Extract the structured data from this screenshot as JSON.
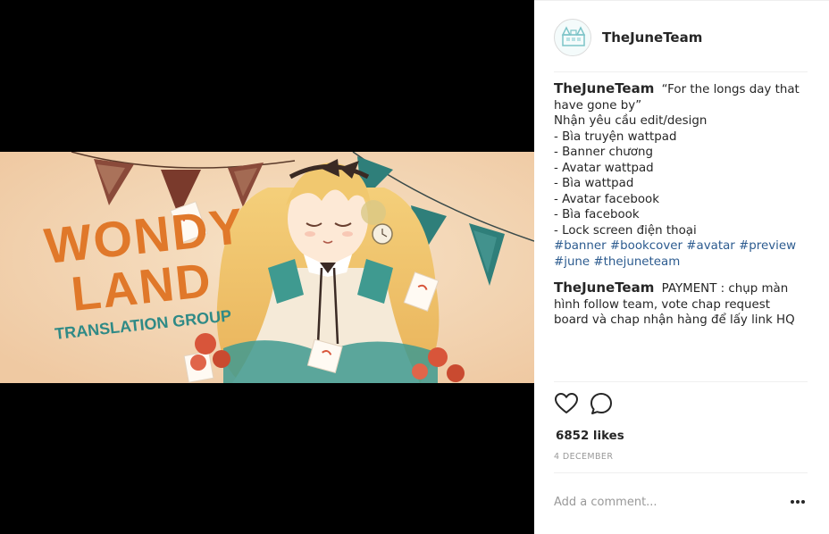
{
  "post": {
    "username": "TheJuneTeam",
    "banner": {
      "title_line1": "WONDY",
      "title_line2": "LAND",
      "subtitle": "TRANSLATION GROUP"
    },
    "caption": {
      "username": "TheJuneTeam",
      "lines": [
        "“For the longs day that have gone by”",
        "Nhận yêu cầu edit/design",
        "- Bìa truyện wattpad",
        "- Banner chương",
        "- Avatar wattpad",
        "- Bìa wattpad",
        "- Avatar facebook",
        "- Bìa facebook",
        "- Lock screen điện thoại"
      ],
      "hashtags": [
        "#banner",
        "#bookcover",
        "#avatar",
        "#preview",
        "#june",
        "#thejuneteam"
      ]
    },
    "comment": {
      "username": "TheJuneTeam",
      "text": "PAYMENT : chụp màn hình follow team, vote chap request board và chap nhận hàng để lấy link HQ"
    },
    "likes": "6852 likes",
    "date": "4 DECEMBER",
    "add_comment_placeholder": "Add a comment...",
    "icons": {
      "like": "heart-icon",
      "comment": "speech-bubble-icon",
      "more": "more-options-icon"
    },
    "colors": {
      "link": "#2c5b8f",
      "title_orange": "#e0782a",
      "subtitle_teal": "#2f8a86",
      "banner_bg": "#f3d6b6"
    }
  }
}
